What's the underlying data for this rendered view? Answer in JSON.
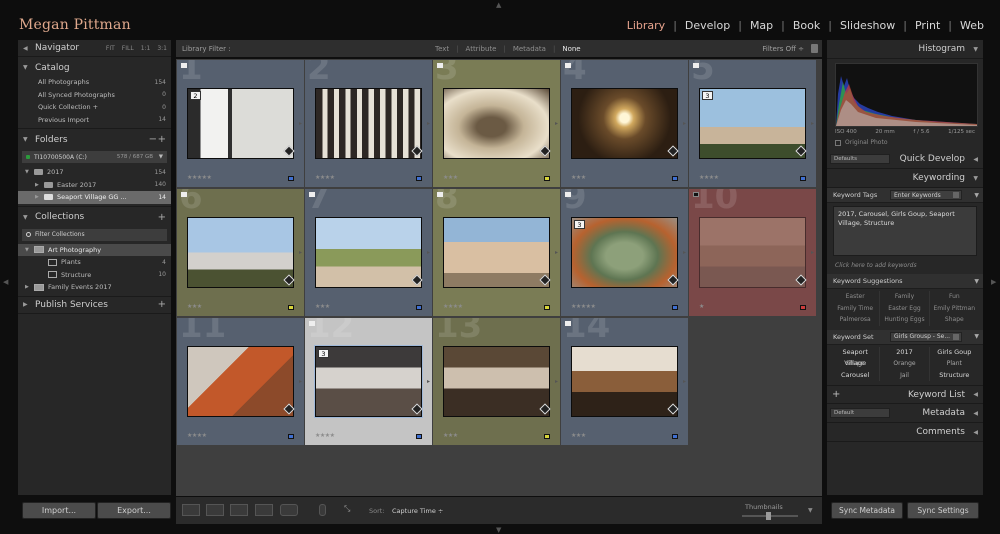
{
  "identity_plate": "Megan Pittman",
  "modules": [
    {
      "label": "Library",
      "active": true
    },
    {
      "label": "Develop"
    },
    {
      "label": "Map"
    },
    {
      "label": "Book"
    },
    {
      "label": "Slideshow"
    },
    {
      "label": "Print"
    },
    {
      "label": "Web"
    }
  ],
  "navigator": {
    "title": "Navigator",
    "zoom_options": [
      "FIT",
      "FILL",
      "1:1",
      "3:1"
    ]
  },
  "catalog": {
    "title": "Catalog",
    "items": [
      {
        "label": "All Photographs",
        "count": "154"
      },
      {
        "label": "All Synced Photographs",
        "count": "0"
      },
      {
        "label": "Quick Collection +",
        "count": "0"
      },
      {
        "label": "Previous Import",
        "count": "14"
      }
    ]
  },
  "folders": {
    "title": "Folders",
    "volume": {
      "name": "TI10700500A (C:)",
      "space": "578 / 687 GB"
    },
    "items": [
      {
        "label": "2017",
        "count": "154"
      },
      {
        "label": "Easter 2017",
        "count": "140"
      },
      {
        "label": "Seaport Village GG ...",
        "count": "14"
      }
    ]
  },
  "collections": {
    "title": "Collections",
    "filter_placeholder": "Filter Collections",
    "items": [
      {
        "label": "Art Photography",
        "count": ""
      },
      {
        "label": "Plants",
        "count": "4"
      },
      {
        "label": "Structure",
        "count": "10"
      },
      {
        "label": "Family Events 2017",
        "count": ""
      }
    ]
  },
  "publish_services": {
    "title": "Publish Services"
  },
  "left_buttons": {
    "import": "Import...",
    "export": "Export..."
  },
  "library_filter": {
    "label": "Library Filter :",
    "options": [
      {
        "label": "Text"
      },
      {
        "label": "Attribute"
      },
      {
        "label": "Metadata"
      },
      {
        "label": "None",
        "active": true
      }
    ],
    "preset": "Filters Off ÷"
  },
  "grid_cells": [
    {
      "number": "1",
      "bg": "#56606f",
      "stars": "★★★★★",
      "label": "#3f6fd0",
      "stack": "2",
      "photo": "jail1",
      "flag": "white"
    },
    {
      "number": "2",
      "bg": "#56606f",
      "stars": "★★★★",
      "label": "#3f6fd0",
      "stack": "",
      "photo": "jail2",
      "flag": "none"
    },
    {
      "number": "3",
      "bg": "#7a7c55",
      "stars": "★★★",
      "label": "#d8d63a",
      "stack": "",
      "photo": "corridor",
      "flag": "white"
    },
    {
      "number": "4",
      "bg": "#56606f",
      "stars": "★★★",
      "label": "#3f6fd0",
      "stack": "",
      "photo": "lamp",
      "flag": "white"
    },
    {
      "number": "5",
      "bg": "#56606f",
      "stars": "★★★★",
      "label": "#3f6fd0",
      "stack": "3",
      "photo": "tower",
      "flag": "white"
    },
    {
      "number": "6",
      "bg": "#6e6f4e",
      "stars": "★★★",
      "label": "#d8d63a",
      "stack": "",
      "photo": "tower2",
      "flag": "white"
    },
    {
      "number": "7",
      "bg": "#56606f",
      "stars": "★★★",
      "label": "#3f6fd0",
      "stack": "",
      "photo": "palms",
      "flag": "white"
    },
    {
      "number": "8",
      "bg": "#7a7c55",
      "stars": "★★★★",
      "label": "#d8d63a",
      "stack": "",
      "photo": "street",
      "flag": "white"
    },
    {
      "number": "9",
      "bg": "#56606f",
      "stars": "★★★★★",
      "label": "#3f6fd0",
      "stack": "3",
      "photo": "agave",
      "flag": "white"
    },
    {
      "number": "10",
      "bg": "#7a4848",
      "stars": "★",
      "label": "#cc3b3b",
      "stack": "",
      "photo": "planter",
      "flag": "black",
      "dim": true
    },
    {
      "number": "11",
      "bg": "#56606f",
      "stars": "★★★★",
      "label": "#3f6fd0",
      "stack": "",
      "photo": "rust",
      "flag": "none"
    },
    {
      "number": "12",
      "bg": "#c4c4c4",
      "stars": "★★★★",
      "label": "#3f6fd0",
      "stack": "3",
      "photo": "carousel",
      "flag": "white",
      "selected": true
    },
    {
      "number": "13",
      "bg": "#6e6f4e",
      "stars": "★★★",
      "label": "#d8d63a",
      "stack": "",
      "photo": "carousel2",
      "flag": "none"
    },
    {
      "number": "14",
      "bg": "#56606f",
      "stars": "★★★",
      "label": "#3f6fd0",
      "stack": "",
      "photo": "carousel3",
      "flag": "white"
    }
  ],
  "toolbar": {
    "sort_label": "Sort:",
    "sort_value": "Capture Time ÷",
    "thumbnails_label": "Thumbnails"
  },
  "histogram": {
    "title": "Histogram",
    "iso": "ISO 400",
    "focal": "20 mm",
    "aperture": "f / 5.6",
    "shutter": "1/125 sec",
    "original_photo": "Original Photo"
  },
  "quick_develop": {
    "title": "Quick Develop",
    "preset": "Defaults"
  },
  "keywording": {
    "title": "Keywording",
    "tags_label": "Keyword Tags",
    "tags_mode": "Enter Keywords",
    "keywords_text": "2017, Carousel, Girls Goup, Seaport Village, Structure",
    "hint": "Click here to add keywords",
    "suggestions_label": "Keyword Suggestions",
    "suggestions": [
      "Easter",
      "Family",
      "Fun",
      "Family Time",
      "Easter Egg",
      "Emily Pittman",
      "Palmerosa",
      "Hunting Eggs",
      "Shape"
    ],
    "set_label": "Keyword Set",
    "set_value": "Girls Grousp - Se...",
    "set_keywords": [
      {
        "label": "Seaport Village",
        "dim": false
      },
      {
        "label": "2017",
        "dim": false
      },
      {
        "label": "Girls Goup",
        "dim": false
      },
      {
        "label": "Shape",
        "dim": true
      },
      {
        "label": "Orange",
        "dim": true
      },
      {
        "label": "Plant",
        "dim": true
      },
      {
        "label": "Carousel",
        "dim": false
      },
      {
        "label": "Jail",
        "dim": true
      },
      {
        "label": "Structure",
        "dim": false
      }
    ]
  },
  "keyword_list": {
    "title": "Keyword List"
  },
  "metadata": {
    "title": "Metadata",
    "preset": "Default"
  },
  "comments": {
    "title": "Comments"
  },
  "right_buttons": {
    "sync_metadata": "Sync Metadata",
    "sync_settings": "Sync Settings"
  }
}
